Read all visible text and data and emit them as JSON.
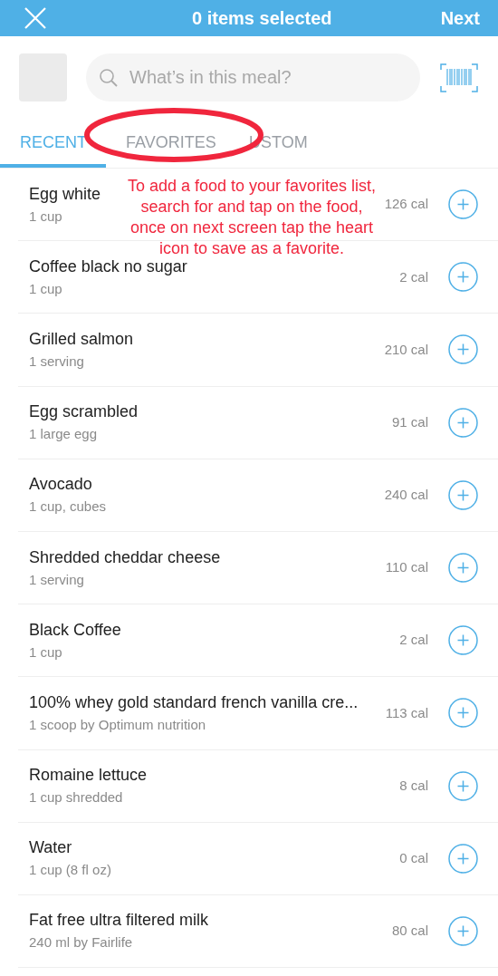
{
  "header": {
    "title": "0 items selected",
    "next": "Next"
  },
  "search": {
    "placeholder": "What’s in this meal?"
  },
  "tabs": [
    {
      "label": "RECENT",
      "selected": true
    },
    {
      "label": "FAVORITES",
      "selected": false
    },
    {
      "label": "USTOM",
      "selected": false
    }
  ],
  "annotation": {
    "lines": [
      "To add a food to your favorites list,",
      "search for and tap on the food,",
      "once on next screen tap the heart",
      "icon to save as a favorite."
    ]
  },
  "foods": [
    {
      "name": "Egg white",
      "serving": "1 cup",
      "calories": "126 cal"
    },
    {
      "name": "Coffee black no sugar",
      "serving": "1 cup",
      "calories": "2 cal"
    },
    {
      "name": "Grilled salmon",
      "serving": "1 serving",
      "calories": "210 cal"
    },
    {
      "name": "Egg scrambled",
      "serving": "1 large egg",
      "calories": "91 cal"
    },
    {
      "name": "Avocado",
      "serving": "1 cup, cubes",
      "calories": "240 cal"
    },
    {
      "name": "Shredded cheddar cheese",
      "serving": "1 serving",
      "calories": "110 cal"
    },
    {
      "name": "Black Coffee",
      "serving": "1 cup",
      "calories": "2 cal"
    },
    {
      "name": "100% whey gold standard french vanilla cre...",
      "serving": "1 scoop by Optimum nutrition",
      "calories": "113 cal"
    },
    {
      "name": "Romaine lettuce",
      "serving": "1 cup shredded",
      "calories": "8 cal"
    },
    {
      "name": "Water",
      "serving": "1 cup (8 fl oz)",
      "calories": "0 cal"
    },
    {
      "name": "Fat free ultra filtered milk",
      "serving": "240 ml by Fairlife",
      "calories": "80 cal"
    }
  ]
}
